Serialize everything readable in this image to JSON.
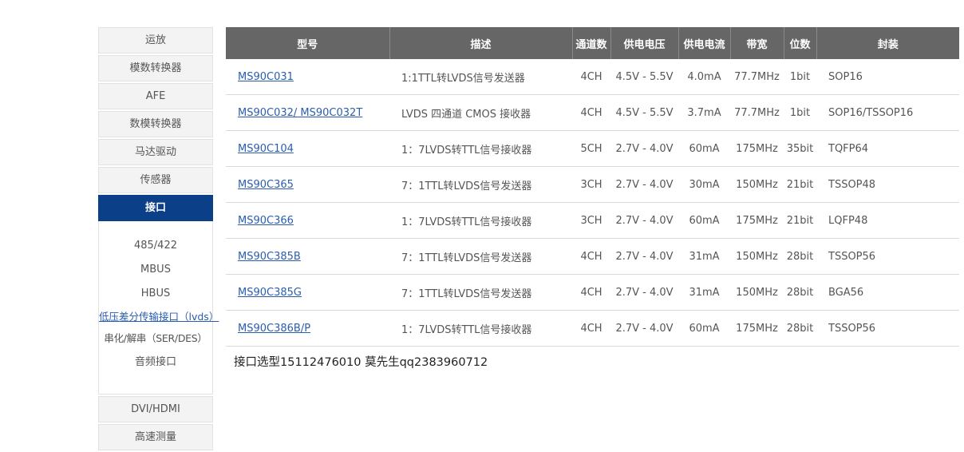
{
  "sidebar": {
    "categories_top": [
      "运放",
      "模数转换器",
      "AFE",
      "数模转换器",
      "马达驱动",
      "传感器"
    ],
    "active_category": "接口",
    "subitems": [
      "485/422",
      "MBUS",
      "HBUS"
    ],
    "link_item": "低压差分传输接口（lvds）",
    "subitems_after": [
      "串化/解串（SER/DES）",
      "音频接口"
    ],
    "categories_bottom": [
      "DVI/HDMI",
      "高速测量"
    ]
  },
  "table": {
    "headers": [
      "型号",
      "描述",
      "通道数",
      "供电电压",
      "供电电流",
      "带宽",
      "位数",
      "封装"
    ],
    "rows": [
      [
        "MS90C031",
        "1:1TTL转LVDS信号发送器",
        "4CH",
        "4.5V - 5.5V",
        "4.0mA",
        "77.7MHz",
        "1bit",
        "SOP16"
      ],
      [
        "MS90C032/ MS90C032T",
        "LVDS 四通道 CMOS 接收器",
        "4CH",
        "4.5V - 5.5V",
        "3.7mA",
        "77.7MHz",
        "1bit",
        "SOP16/TSSOP16"
      ],
      [
        "MS90C104",
        "1：7LVDS转TTL信号接收器",
        "5CH",
        "2.7V - 4.0V",
        "60mA",
        "175MHz",
        "35bit",
        "TQFP64"
      ],
      [
        "MS90C365",
        "7：1TTL转LVDS信号发送器",
        "3CH",
        "2.7V - 4.0V",
        "30mA",
        "150MHz",
        "21bit",
        "TSSOP48"
      ],
      [
        "MS90C366",
        "1：7LVDS转TTL信号接收器",
        "3CH",
        "2.7V - 4.0V",
        "60mA",
        "175MHz",
        "21bit",
        "LQFP48"
      ],
      [
        "MS90C385B",
        "7：1TTL转LVDS信号发送器",
        "4CH",
        "2.7V - 4.0V",
        "31mA",
        "150MHz",
        "28bit",
        "TSSOP56"
      ],
      [
        "MS90C385G",
        "7：1TTL转LVDS信号发送器",
        "4CH",
        "2.7V - 4.0V",
        "31mA",
        "150MHz",
        "28bit",
        "BGA56"
      ],
      [
        "MS90C386B/P",
        "1：7LVDS转TTL信号接收器",
        "4CH",
        "2.7V - 4.0V",
        "60mA",
        "175MHz",
        "28bit",
        "TSSOP56"
      ]
    ]
  },
  "contact": "接口选型15112476010 莫先生qq2383960712",
  "colors": {
    "header_bg": "#666666",
    "active_bg": "#0b3f87",
    "link": "#2a5db0"
  }
}
